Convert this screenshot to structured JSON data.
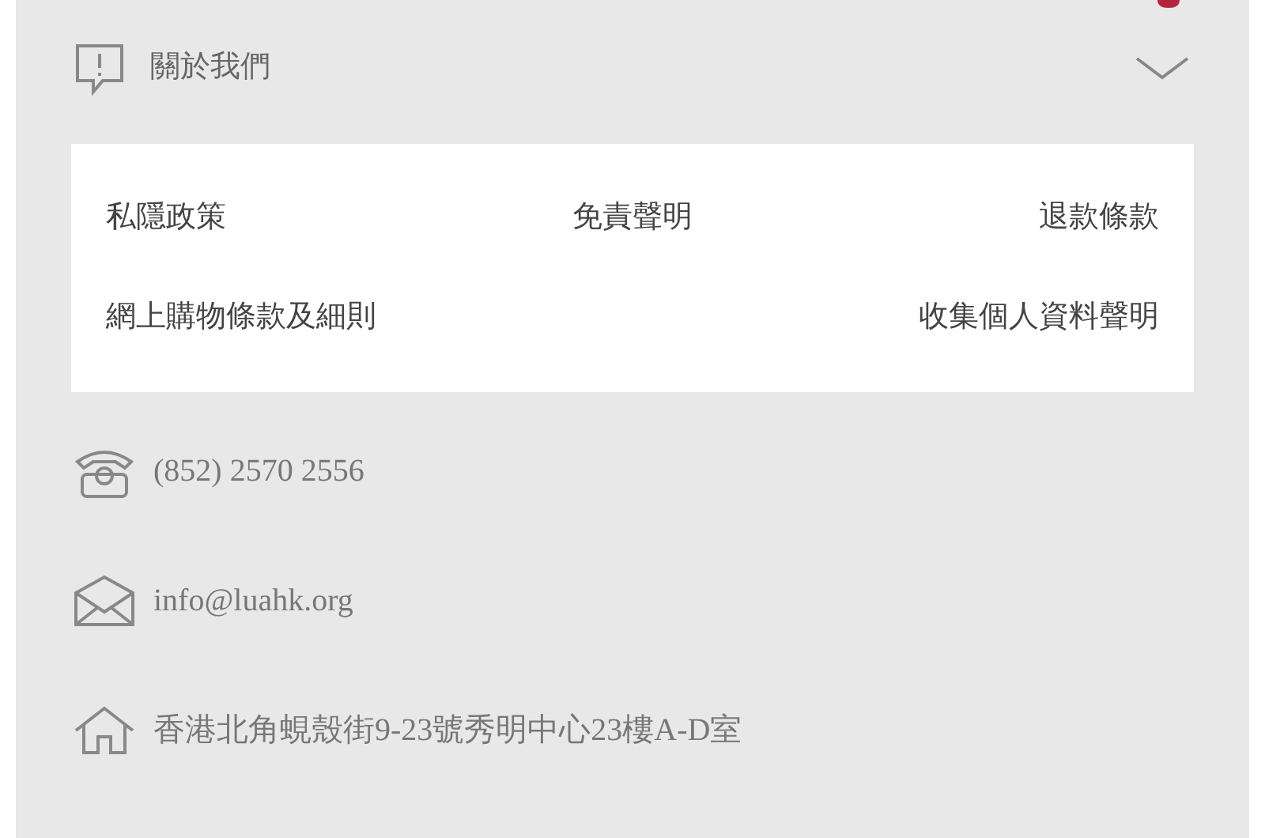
{
  "about": {
    "title": "關於我們",
    "expanded": true,
    "link_rows": [
      [
        "私隱政策",
        "免責聲明",
        "退款條款"
      ],
      [
        "網上購物條款及細則",
        "收集個人資料聲明"
      ]
    ]
  },
  "contacts": [
    {
      "kind": "phone",
      "text": "(852) 2570 2556"
    },
    {
      "kind": "email",
      "text": "info@luahk.org"
    },
    {
      "kind": "address",
      "text": "香港北角蜆殼街9-23號秀明中心23樓A-D室"
    }
  ]
}
